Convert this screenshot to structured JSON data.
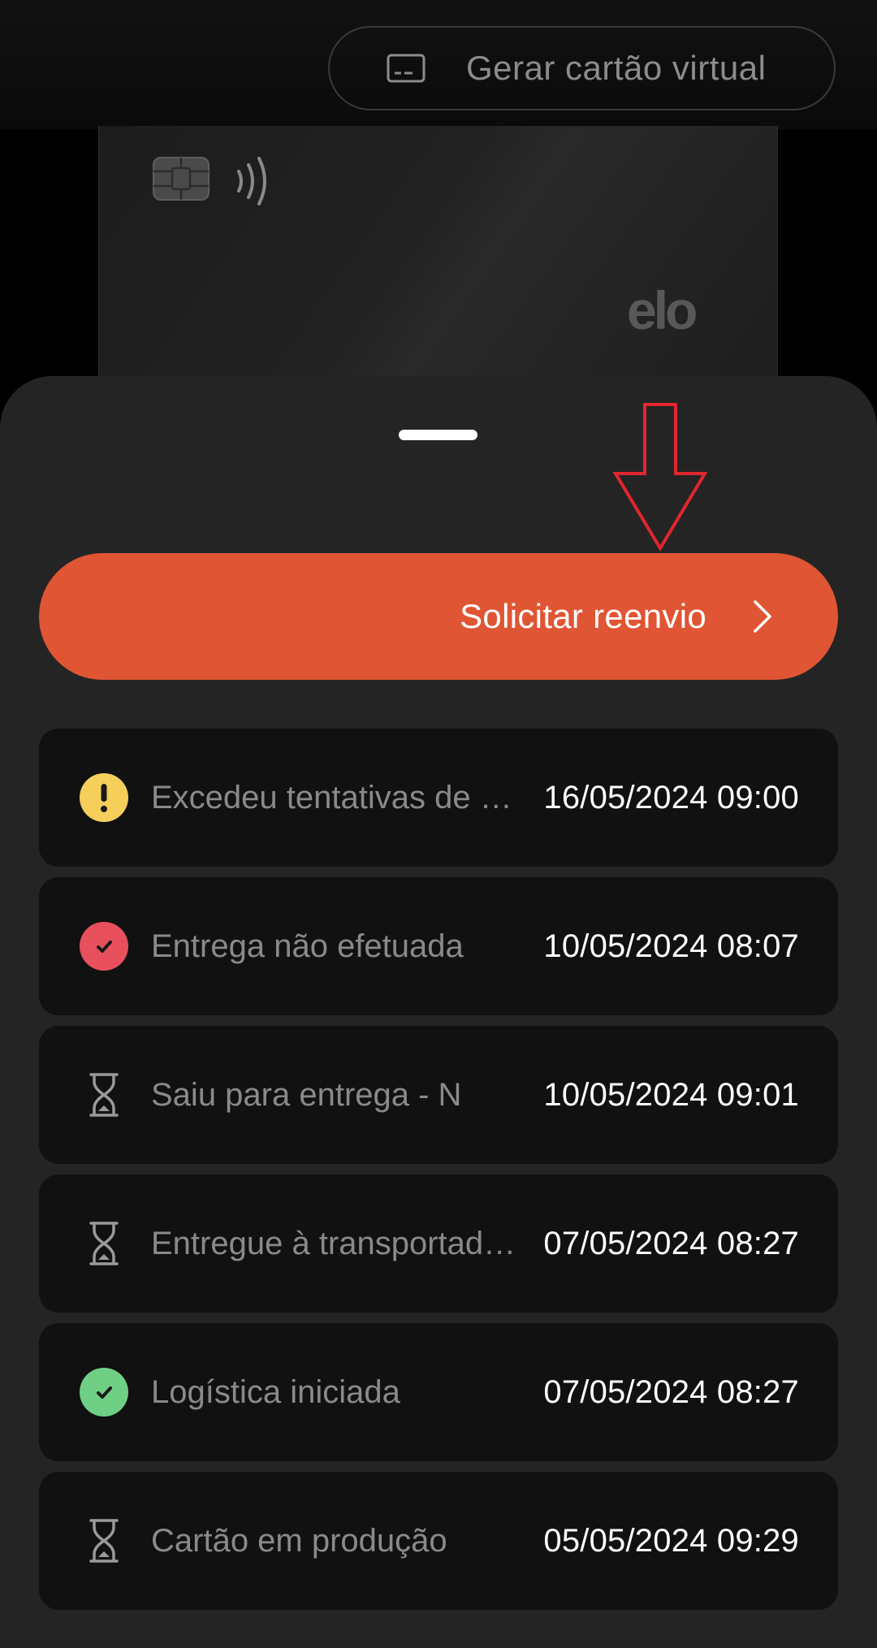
{
  "header": {
    "virtual_card_button_label": "Gerar cartão virtual",
    "virtual_card_icon": "card-outline-icon"
  },
  "card": {
    "brand": "elo",
    "chip_icon": "chip-icon",
    "contactless_icon": "contactless-icon"
  },
  "sheet": {
    "resend_button_label": "Solicitar reenvio",
    "resend_button_icon": "chevron-right-icon"
  },
  "statuses": [
    {
      "text": "Excedeu tentativas de entrega",
      "date": "16/05/2024 09:00",
      "icon": "warning-icon",
      "color": "#f5cf5a"
    },
    {
      "text": "Entrega não efetuada",
      "date": "10/05/2024 08:07",
      "icon": "check-red-icon",
      "color": "#e8505e"
    },
    {
      "text": "Saiu para entrega - N",
      "date": "10/05/2024 09:01",
      "icon": "hourglass-icon",
      "color": "#9a9a9a"
    },
    {
      "text": "Entregue à transportadora",
      "date": "07/05/2024 08:27",
      "icon": "hourglass-icon",
      "color": "#9a9a9a"
    },
    {
      "text": "Logística iniciada",
      "date": "07/05/2024 08:27",
      "icon": "check-green-icon",
      "color": "#6fcf85"
    },
    {
      "text": "Cartão em produção",
      "date": "05/05/2024 09:29",
      "icon": "hourglass-icon",
      "color": "#9a9a9a"
    }
  ],
  "colors": {
    "accent": "#e05533",
    "sheet_background": "#242424",
    "row_background": "#111111",
    "annotation": "#e0262e"
  }
}
